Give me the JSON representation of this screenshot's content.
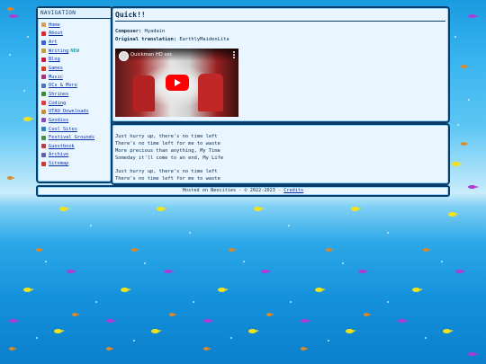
{
  "nav": {
    "title": "NAVIGATION",
    "items": [
      {
        "label": "Home",
        "icon": "pencil-icon",
        "color": "#d0a060"
      },
      {
        "label": "About",
        "icon": "star-icon",
        "color": "#d03030"
      },
      {
        "label": "Art",
        "icon": "palette-icon",
        "color": "#4060d0"
      },
      {
        "label": "Writing",
        "icon": "pen-icon",
        "color": "#c0a040",
        "badge": "NEW"
      },
      {
        "label": "Blog",
        "icon": "heart-icon",
        "color": "#c02040"
      },
      {
        "label": "Games",
        "icon": "controller-icon",
        "color": "#d04020"
      },
      {
        "label": "Music",
        "icon": "note-icon",
        "color": "#a03080"
      },
      {
        "label": "OCs & More",
        "icon": "people-icon",
        "color": "#5070c0"
      },
      {
        "label": "Shrines",
        "icon": "shrine-icon",
        "color": "#3a8a3a"
      },
      {
        "label": "Coding",
        "icon": "code-icon",
        "color": "#d04050"
      },
      {
        "label": "UTAU Downloads",
        "icon": "download-icon",
        "color": "#c09040"
      },
      {
        "label": "Goodies",
        "icon": "gift-icon",
        "color": "#8050b0"
      },
      {
        "label": "Cool Sites",
        "icon": "globe-icon",
        "color": "#3080c0"
      },
      {
        "label": "Festival Grounds",
        "icon": "tent-icon",
        "color": "#4a8a4a"
      },
      {
        "label": "Guestbook",
        "icon": "book-icon",
        "color": "#b04050"
      },
      {
        "label": "Archive",
        "icon": "archive-icon",
        "color": "#6060b0"
      },
      {
        "label": "Sitemap",
        "icon": "map-icon",
        "color": "#c04030"
      }
    ]
  },
  "header": {
    "title": "Quick!!",
    "composer_label": "Composer:",
    "composer": "Hyadain",
    "translation_label": "Original translation:",
    "translation": "EarthlyMaidenLita"
  },
  "video": {
    "title": "Quickman HD ver.",
    "colors": {
      "play": "#ff0000"
    }
  },
  "lyrics": {
    "stanza1": [
      "Just hurry up, there's no time left",
      "There's no time left for me to waste",
      "More precious than anything, My Time",
      "Someday it'll come to an end, My Life"
    ],
    "stanza2": [
      "Just hurry up, there's no time left",
      "There's no time left for me to waste"
    ]
  },
  "footer": {
    "text": "Hosted on Neocities - © 2022-2023 -",
    "credits": "Credits"
  }
}
